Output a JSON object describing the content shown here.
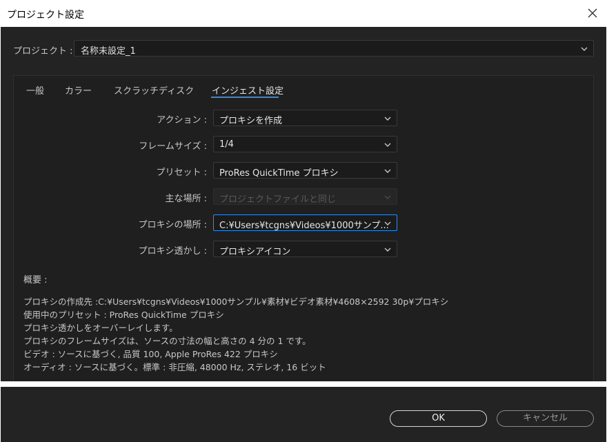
{
  "window": {
    "title": "プロジェクト設定"
  },
  "project": {
    "label": "プロジェクト :",
    "value": "名称未設定_1"
  },
  "tabs": [
    {
      "label": "一般",
      "active": false
    },
    {
      "label": "カラー",
      "active": false
    },
    {
      "label": "スクラッチディスク",
      "active": false
    },
    {
      "label": "インジェスト設定",
      "active": true
    }
  ],
  "settings": {
    "action": {
      "label": "アクション :",
      "value": "プロキシを作成"
    },
    "frame_size": {
      "label": "フレームサイズ :",
      "value": "1/4"
    },
    "preset": {
      "label": "プリセット :",
      "value": "ProRes QuickTime プロキシ"
    },
    "primary_location": {
      "label": "主な場所 :",
      "value": "プロジェクトファイルと同じ",
      "disabled": true
    },
    "proxy_location": {
      "label": "プロキシの場所 :",
      "value": "C:¥Users¥tcgns¥Videos¥1000サンプ...",
      "focused": true
    },
    "watermark": {
      "label": "プロキシ透かし :",
      "value": "プロキシアイコン"
    }
  },
  "summary": {
    "title": "概要 :",
    "lines": [
      "プロキシの作成先 :C:¥Users¥tcgns¥Videos¥1000サンプル¥素材¥ビデオ素材¥4608×2592 30p¥プロキシ",
      "使用中のプリセット : ProRes QuickTime プロキシ",
      "プロキシ透かしをオーバーレイします。",
      "プロキシのフレームサイズは、ソースの寸法の幅と高さの 4 分の 1 です。",
      "ビデオ : ソースに基づく, 品質 100, Apple ProRes 422 プロキシ",
      "オーディオ : ソースに基づく。標準 : 非圧縮, 48000 Hz, ステレオ, 16 ビット"
    ]
  },
  "buttons": {
    "ok": "OK",
    "cancel": "キャンセル"
  },
  "colors": {
    "accent": "#2f8cf1",
    "background": "#232323",
    "panel": "#1f1f1f"
  },
  "icons": {
    "close": "close-icon",
    "dropdown": "chevron-down-icon"
  }
}
